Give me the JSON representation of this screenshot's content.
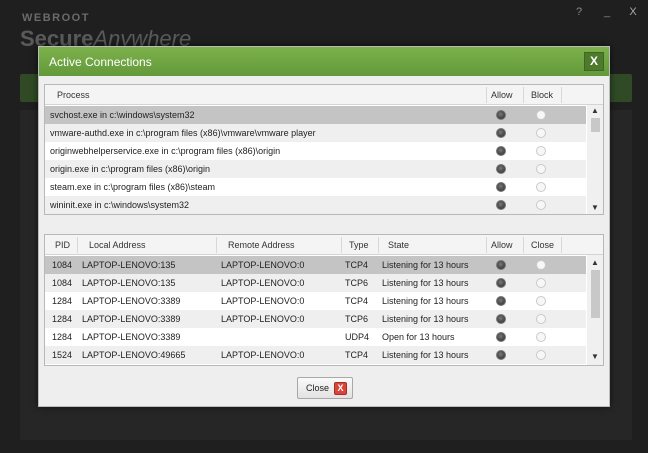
{
  "background": {
    "brand_line1": "WEBROOT",
    "brand_line2_bold": "Secure",
    "brand_line2_rest": "Anywhere",
    "help_glyph": "?",
    "minimize_glyph": "_",
    "close_glyph": "X"
  },
  "dialog": {
    "title": "Active Connections",
    "close_glyph": "X",
    "close_button_label": "Close",
    "close_button_glyph": "X"
  },
  "process_table": {
    "headers": {
      "process": "Process",
      "allow": "Allow",
      "block": "Block"
    },
    "rows": [
      {
        "process": "svchost.exe in c:\\windows\\system32",
        "allow": true
      },
      {
        "process": "vmware-authd.exe in c:\\program files (x86)\\vmware\\vmware player",
        "allow": true
      },
      {
        "process": "originwebhelperservice.exe in c:\\program files (x86)\\origin",
        "allow": true
      },
      {
        "process": "origin.exe in c:\\program files (x86)\\origin",
        "allow": true
      },
      {
        "process": "steam.exe in c:\\program files (x86)\\steam",
        "allow": true
      },
      {
        "process": "wininit.exe in c:\\windows\\system32",
        "allow": true
      }
    ]
  },
  "connection_table": {
    "headers": {
      "pid": "PID",
      "local": "Local Address",
      "remote": "Remote Address",
      "type": "Type",
      "state": "State",
      "allow": "Allow",
      "close": "Close"
    },
    "rows": [
      {
        "pid": "1084",
        "local": "LAPTOP-LENOVO:135",
        "remote": "LAPTOP-LENOVO:0",
        "type": "TCP4",
        "state": "Listening for 13 hours"
      },
      {
        "pid": "1084",
        "local": "LAPTOP-LENOVO:135",
        "remote": "LAPTOP-LENOVO:0",
        "type": "TCP6",
        "state": "Listening for 13 hours"
      },
      {
        "pid": "1284",
        "local": "LAPTOP-LENOVO:3389",
        "remote": "LAPTOP-LENOVO:0",
        "type": "TCP4",
        "state": "Listening for 13 hours"
      },
      {
        "pid": "1284",
        "local": "LAPTOP-LENOVO:3389",
        "remote": "LAPTOP-LENOVO:0",
        "type": "TCP6",
        "state": "Listening for 13 hours"
      },
      {
        "pid": "1284",
        "local": "LAPTOP-LENOVO:3389",
        "remote": "",
        "type": "UDP4",
        "state": "Open for 13 hours"
      },
      {
        "pid": "1524",
        "local": "LAPTOP-LENOVO:49665",
        "remote": "LAPTOP-LENOVO:0",
        "type": "TCP4",
        "state": "Listening for 13 hours"
      }
    ]
  },
  "colors": {
    "title_green": "#6aa33f",
    "selected_row": "#c4c4c4",
    "close_icon_red": "#d9453a"
  },
  "icons": {
    "up": "scroll-up-icon",
    "down": "scroll-down-icon",
    "close": "close-icon"
  }
}
